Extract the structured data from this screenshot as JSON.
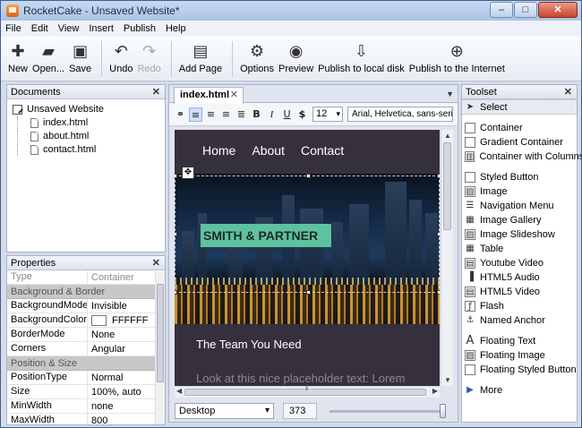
{
  "window": {
    "title": "RocketCake - Unsaved Website*",
    "controls": [
      "–",
      "□",
      "✕"
    ]
  },
  "menu": [
    "File",
    "Edit",
    "View",
    "Insert",
    "Publish",
    "Help"
  ],
  "toolbar": {
    "new": "New",
    "open": "Open...",
    "save": "Save",
    "undo": "Undo",
    "redo": "Redo",
    "add_page": "Add Page",
    "options": "Options",
    "preview": "Preview",
    "publish_local": "Publish to local disk",
    "publish_internet": "Publish to the Internet"
  },
  "documents": {
    "title": "Documents",
    "root": "Unsaved Website",
    "pages": [
      "index.html",
      "about.html",
      "contact.html"
    ]
  },
  "properties": {
    "title": "Properties",
    "header": {
      "key": "Type",
      "value": "Container"
    },
    "sections": [
      {
        "category": "Background & Border",
        "rows": [
          {
            "key": "BackgroundMode",
            "value": "Invisible"
          },
          {
            "key": "BackgroundColor",
            "value": "FFFFFF"
          },
          {
            "key": "BorderMode",
            "value": "None"
          },
          {
            "key": "Corners",
            "value": "Angular"
          }
        ]
      },
      {
        "category": "Position & Size",
        "rows": [
          {
            "key": "PositionType",
            "value": "Normal"
          },
          {
            "key": "Size",
            "value": "100%, auto"
          },
          {
            "key": "MinWidth",
            "value": "none"
          },
          {
            "key": "MaxWidth",
            "value": "800"
          }
        ]
      }
    ]
  },
  "editor": {
    "tab": "index.html",
    "font_size": "12",
    "font_family": "Arial, Helvetica, sans-serif",
    "site_nav": [
      "Home",
      "About",
      "Contact"
    ],
    "brand": "SMITH & PARTNER",
    "team_text": "The Team You Need",
    "placeholder_text": "Look at this nice placeholder text: Lorem",
    "device": "Desktop",
    "width_value": "373"
  },
  "toolset": {
    "title": "Toolset",
    "select": "Select",
    "groups": [
      [
        "Container",
        "Gradient Container",
        "Container with Columns"
      ],
      [
        "Styled Button",
        "Image",
        "Navigation Menu",
        "Image Gallery",
        "Image Slideshow",
        "Table",
        "Youtube Video",
        "HTML5 Audio",
        "HTML5 Video",
        "Flash",
        "Named Anchor"
      ],
      [
        "Floating Text",
        "Floating Image",
        "Floating Styled Button"
      ]
    ],
    "more": "More"
  }
}
